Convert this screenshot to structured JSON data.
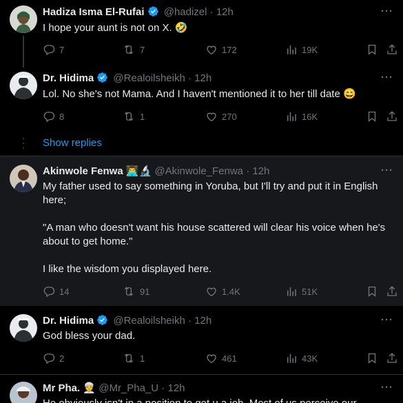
{
  "tweets": [
    {
      "name": "Hadiza Isma El-Rufai",
      "handle": "@hadizel",
      "time": "12h",
      "text": "I hope your aunt is not on X. 🤣",
      "replies": "7",
      "reposts": "7",
      "likes": "172",
      "views": "19K"
    },
    {
      "name": "Dr. Hidima",
      "handle": "@Realoilsheikh",
      "time": "12h",
      "text": "Lol. No she's not Mama. And I haven't mentioned it to her till date 😄",
      "replies": "8",
      "reposts": "1",
      "likes": "270",
      "views": "16K"
    },
    {
      "name": "Akinwole Fenwa",
      "name_emoji": "👨‍💻🔬",
      "handle": "@Akinwole_Fenwa",
      "time": "12h",
      "text_lines": [
        "My father used to say something in Yoruba, but I'll try and put it in English",
        "here;",
        "",
        "\"A man who doesn't want his house scattered will clear his voice when he's",
        "about to get home.\"",
        "",
        "I like the wisdom you displayed here."
      ],
      "replies": "14",
      "reposts": "91",
      "likes": "1.4K",
      "views": "51K"
    },
    {
      "name": "Dr. Hidima",
      "handle": "@Realoilsheikh",
      "time": "12h",
      "text": "God bless your dad.",
      "replies": "2",
      "reposts": "1",
      "likes": "461",
      "views": "43K"
    },
    {
      "name": "Mr Pha.",
      "name_emoji": "👳",
      "handle": "@Mr_Pha_U",
      "time": "12h",
      "text": "He obviously isn't in a position to get u a job. Most of us perceive our"
    }
  ],
  "show_replies": "Show replies",
  "separator": "·",
  "more": "···",
  "colors": {
    "accent": "#1d9bf0",
    "muted": "#71767b",
    "text": "#e7e9ea",
    "bg": "#000000",
    "verified": "#1d9bf0"
  },
  "icons": [
    "reply-icon",
    "repost-icon",
    "like-icon",
    "views-icon",
    "bookmark-icon",
    "share-icon",
    "verified-icon",
    "more-icon"
  ]
}
